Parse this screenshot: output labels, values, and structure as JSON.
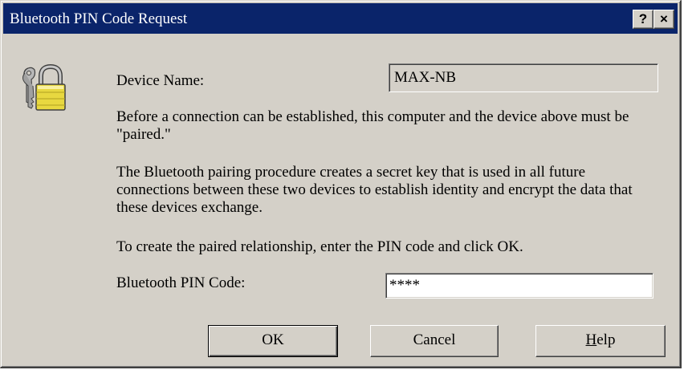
{
  "window": {
    "title": "Bluetooth PIN Code Request",
    "help_button": "?",
    "close_button": "×"
  },
  "icon": "lock-keys-icon",
  "device": {
    "label": "Device Name:",
    "value": "MAX-NB"
  },
  "paragraphs": {
    "p1": "Before a connection can be established, this computer and the device above must be \"paired.\"",
    "p2": "The Bluetooth pairing procedure creates a secret key that is used in all future connections between these two devices to establish identity and encrypt the data that these devices exchange.",
    "p3": "To create the paired relationship, enter the PIN code and click OK."
  },
  "pin": {
    "label": "Bluetooth PIN Code:",
    "value": "****"
  },
  "buttons": {
    "ok": "OK",
    "cancel": "Cancel",
    "help_first": "H",
    "help_rest": "elp"
  }
}
